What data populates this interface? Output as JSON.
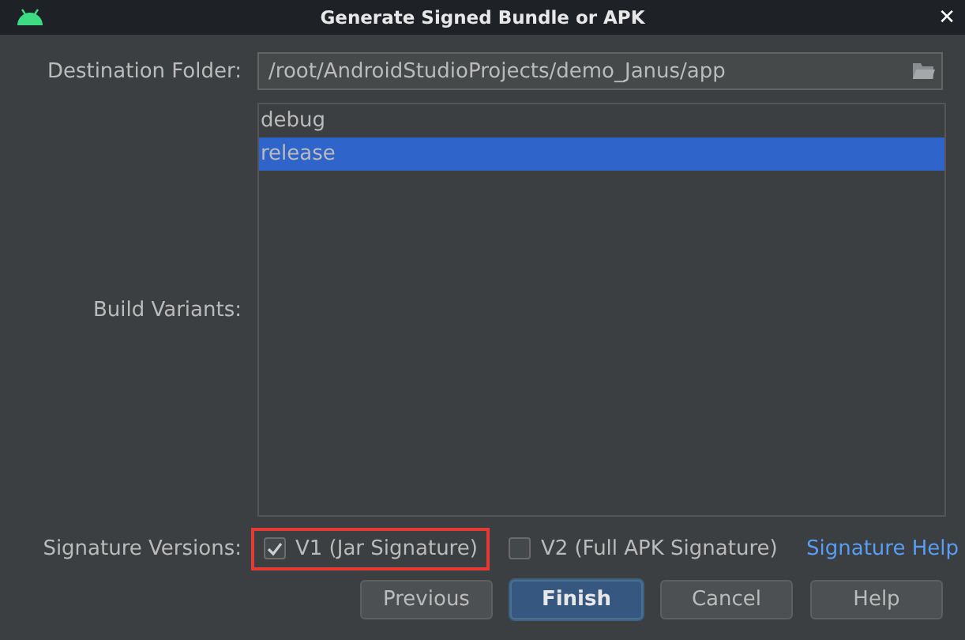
{
  "window": {
    "title": "Generate Signed Bundle or APK",
    "close": "✕"
  },
  "destination": {
    "label": "Destination Folder:",
    "value": "/root/AndroidStudioProjects/demo_Janus/app"
  },
  "build_variants": {
    "label": "Build Variants:",
    "items": [
      {
        "label": "debug",
        "selected": false
      },
      {
        "label": "release",
        "selected": true
      }
    ]
  },
  "signature_versions": {
    "label": "Signature Versions:",
    "options": [
      {
        "label": "V1 (Jar Signature)",
        "checked": true,
        "highlighted": true
      },
      {
        "label": "V2 (Full APK Signature)",
        "checked": false,
        "highlighted": false
      }
    ],
    "help_link": "Signature Help"
  },
  "buttons": [
    {
      "label": "Previous",
      "default": false
    },
    {
      "label": "Finish",
      "default": true
    },
    {
      "label": "Cancel",
      "default": false
    },
    {
      "label": "Help",
      "default": false
    }
  ]
}
